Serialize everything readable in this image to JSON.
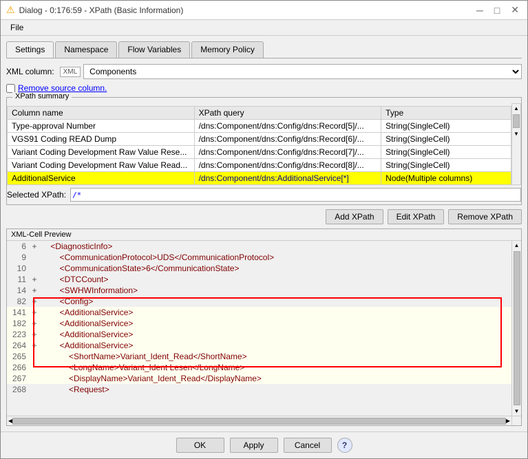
{
  "window": {
    "title": "Dialog - 0:176:59 - XPath (Basic Information)",
    "icon": "⚠",
    "menu": [
      "File"
    ]
  },
  "tabs": [
    {
      "label": "Settings",
      "active": true
    },
    {
      "label": "Namespace",
      "active": false
    },
    {
      "label": "Flow Variables",
      "active": false
    },
    {
      "label": "Memory Policy",
      "active": false
    }
  ],
  "settings": {
    "xml_column_label": "XML column:",
    "xml_badge": "XML",
    "xml_select_value": "Components",
    "remove_source_label": "Remove source column.",
    "xpath_summary_title": "XPath summary",
    "columns": [
      {
        "name": "Column name",
        "xpath": "XPath query",
        "type": "Type"
      }
    ],
    "rows": [
      {
        "name": "Type-approval Number",
        "xpath": "/dns:Component/dns:Config/dns:Record[5]/...",
        "type": "String(SingleCell)",
        "highlight": false
      },
      {
        "name": "VGS91 Coding READ Dump",
        "xpath": "/dns:Component/dns:Config/dns:Record[6]/...",
        "type": "String(SingleCell)",
        "highlight": false
      },
      {
        "name": "Variant Coding Development Raw Value Rese...",
        "xpath": "/dns:Component/dns:Config/dns:Record[7]/...",
        "type": "String(SingleCell)",
        "highlight": false
      },
      {
        "name": "Variant Coding Development Raw Value Read...",
        "xpath": "/dns:Component/dns:Config/dns:Record[8]/...",
        "type": "String(SingleCell)",
        "highlight": false
      },
      {
        "name": "AdditionalService",
        "xpath": "/dns:Component/dns:AdditionalService[*]",
        "type": "Node(Multiple columns)",
        "highlight": true
      }
    ],
    "selected_xpath_label": "Selected XPath:",
    "selected_xpath_value": "/*",
    "buttons": {
      "add": "Add XPath",
      "edit": "Edit XPath",
      "remove": "Remove XPath"
    }
  },
  "xml_preview": {
    "title": "XML-Cell Preview",
    "lines": [
      {
        "num": "6",
        "expander": "+",
        "indent": 1,
        "content": "<DiagnosticInfo>",
        "highlight": false,
        "color": "tag"
      },
      {
        "num": "9",
        "expander": "",
        "indent": 2,
        "content": "<CommunicationProtocol>UDS</CommunicationProtocol>",
        "highlight": false,
        "color": "tag"
      },
      {
        "num": "10",
        "expander": "",
        "indent": 2,
        "content": "<CommunicationState>6</CommunicationState>",
        "highlight": false,
        "color": "tag"
      },
      {
        "num": "11",
        "expander": "+",
        "indent": 2,
        "content": "<DTCCount>",
        "highlight": false,
        "color": "tag"
      },
      {
        "num": "14",
        "expander": "+",
        "indent": 2,
        "content": "<SWHWInformation>",
        "highlight": false,
        "color": "tag"
      },
      {
        "num": "82",
        "expander": "+",
        "indent": 2,
        "content": "<Config>",
        "highlight": false,
        "color": "tag"
      },
      {
        "num": "141",
        "expander": "+",
        "indent": 2,
        "content": "<AdditionalService>",
        "highlight": true,
        "color": "tag"
      },
      {
        "num": "182",
        "expander": "+",
        "indent": 2,
        "content": "<AdditionalService>",
        "highlight": true,
        "color": "tag"
      },
      {
        "num": "223",
        "expander": "+",
        "indent": 2,
        "content": "<AdditionalService>",
        "highlight": true,
        "color": "tag"
      },
      {
        "num": "264",
        "expander": "+",
        "indent": 2,
        "content": "<AdditionalService>",
        "highlight": true,
        "color": "tag"
      },
      {
        "num": "265",
        "expander": "",
        "indent": 3,
        "content": "<ShortName>Variant_Ident_Read</ShortName>",
        "highlight": true,
        "color": "tag"
      },
      {
        "num": "266",
        "expander": "",
        "indent": 3,
        "content": "<LongName>Variant_Ident Lesen</LongName>",
        "highlight": true,
        "color": "tag"
      },
      {
        "num": "267",
        "expander": "",
        "indent": 3,
        "content": "<DisplayName>Variant_Ident_Read</DisplayName>",
        "highlight": true,
        "color": "tag"
      },
      {
        "num": "268",
        "expander": "",
        "indent": 3,
        "content": "<Request>",
        "highlight": false,
        "color": "tag"
      }
    ]
  },
  "bottom_buttons": {
    "ok": "OK",
    "apply": "Apply",
    "cancel": "Cancel",
    "help": "?"
  }
}
